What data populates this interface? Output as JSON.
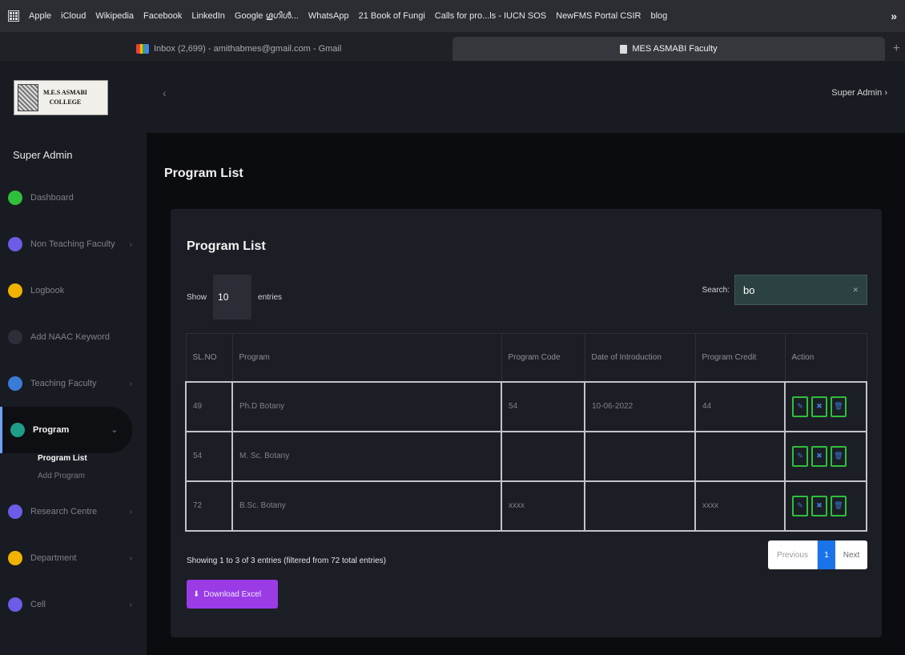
{
  "bookmarks": [
    "Apple",
    "iCloud",
    "Wikipedia",
    "Facebook",
    "LinkedIn",
    "Google ഗൂഗിൾ...",
    "WhatsApp",
    "21 Book of Fungi",
    "Calls for pro...ls - IUCN SOS",
    "NewFMS Portal CSIR",
    "blog"
  ],
  "bookmarks_more": "»",
  "tabs": {
    "gmail": "Inbox (2,699) - amithabmes@gmail.com - Gmail",
    "active": "MES ASMABI Faculty",
    "new_tab": "+"
  },
  "logo": {
    "line1": "M.E.S ASMABI",
    "line2": "COLLEGE"
  },
  "sidebar": {
    "user": "Super Admin",
    "items": [
      {
        "label": "Dashboard",
        "color": "#2fbf3b",
        "chevron": ""
      },
      {
        "label": "Non Teaching Faculty",
        "color": "#6c5ce7",
        "chevron": "›"
      },
      {
        "label": "Logbook",
        "color": "#f0b400",
        "chevron": ""
      },
      {
        "label": "Add NAAC Keyword",
        "color": "#2c2f3a",
        "chevron": ""
      },
      {
        "label": "Teaching Faculty",
        "color": "#3a7bd5",
        "chevron": "›"
      },
      {
        "label": "Program",
        "color": "#1f9d8b",
        "chevron": "⌄"
      },
      {
        "label": "Research Centre",
        "color": "#6c5ce7",
        "chevron": "›"
      },
      {
        "label": "Department",
        "color": "#f0b400",
        "chevron": "›"
      },
      {
        "label": "Cell",
        "color": "#6c5ce7",
        "chevron": "›"
      }
    ],
    "sub_current": "Program List",
    "sub_other": "Add Program"
  },
  "topbar": {
    "back": "‹",
    "admin": "Super Admin ›"
  },
  "page_title": "Program List",
  "card": {
    "title": "Program List",
    "show_label": "Show",
    "entries_value": "10",
    "entries_label": "entries",
    "search_label": "Search:",
    "search_value": "bo",
    "search_clear": "✕"
  },
  "table": {
    "headers": [
      "SL.NO",
      "Program",
      "Program Code",
      "Date of Introduction",
      "Program Credit",
      "Action"
    ],
    "rows": [
      [
        "49",
        "Ph.D Botany",
        "54",
        "10-06-2022",
        "44"
      ],
      [
        "54",
        "M. Sc. Botany",
        "",
        "",
        ""
      ],
      [
        "72",
        "B.Sc. Botany",
        "xxxx",
        "",
        "xxxx"
      ]
    ],
    "actions": [
      "✎",
      "✖",
      "🗑"
    ]
  },
  "info": "Showing 1 to 3 of 3 entries (filtered from 72 total entries)",
  "download": "Download Excel",
  "pager": {
    "prev": "Previous",
    "page": "1",
    "next": "Next"
  }
}
